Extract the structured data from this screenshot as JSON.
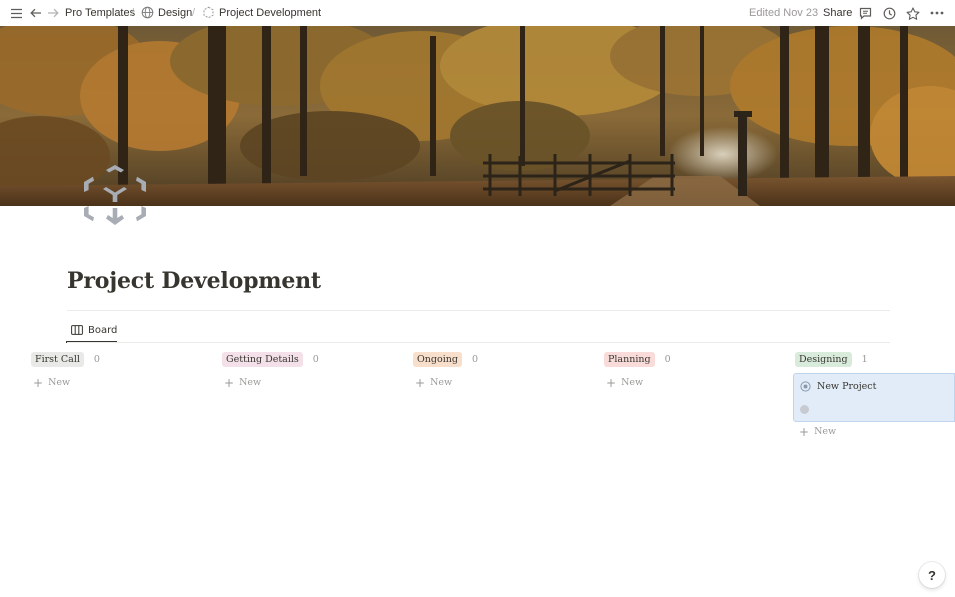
{
  "topbar": {
    "breadcrumbs": [
      {
        "label": "Pro Templates"
      },
      {
        "label": "Design"
      },
      {
        "label": "Project Development"
      }
    ],
    "separator": "/",
    "edited": "Edited Nov 23",
    "share_label": "Share"
  },
  "page": {
    "title": "Project Development"
  },
  "tabs": [
    {
      "label": "Board",
      "icon": "board-icon",
      "active": true
    }
  ],
  "board": {
    "columns": [
      {
        "label": "First Call",
        "count": "0",
        "color": "#e9e9e7",
        "new_label": "New"
      },
      {
        "label": "Getting Details",
        "count": "0",
        "color": "#f3e0e8",
        "new_label": "New"
      },
      {
        "label": "Ongoing",
        "count": "0",
        "color": "#f8dfcc",
        "new_label": "New"
      },
      {
        "label": "Planning",
        "count": "0",
        "color": "#f9dcd9",
        "new_label": "New"
      },
      {
        "label": "Designing",
        "count": "1",
        "color": "#d9ecdc",
        "new_label": "New",
        "cards": [
          {
            "title": "New Project"
          }
        ]
      }
    ]
  },
  "help_label": "?"
}
